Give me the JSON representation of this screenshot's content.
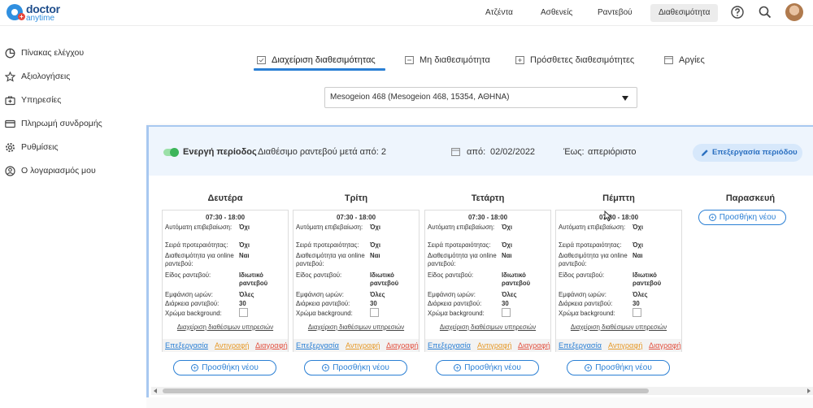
{
  "logo": {
    "line1": "doctor",
    "line2": "anytime"
  },
  "topnav": {
    "items": [
      {
        "label": "Ατζέντα"
      },
      {
        "label": "Ασθενείς"
      },
      {
        "label": "Ραντεβού"
      },
      {
        "label": "Διαθεσιμότητα",
        "active": true
      }
    ]
  },
  "sidebar": {
    "items": [
      {
        "label": "Πίνακας ελέγχου",
        "icon": "pie-chart-icon"
      },
      {
        "label": "Αξιολογήσεις",
        "icon": "star-icon"
      },
      {
        "label": "Υπηρεσίες",
        "icon": "medical-kit-icon"
      },
      {
        "label": "Πληρωμή συνδρομής",
        "icon": "credit-card-icon"
      },
      {
        "label": "Ρυθμίσεις",
        "icon": "gear-icon"
      },
      {
        "label": "Ο λογαριασμός μου",
        "icon": "user-circle-icon"
      }
    ]
  },
  "tabs": [
    {
      "label": "Διαχείριση διαθεσιμότητας",
      "active": true
    },
    {
      "label": "Μη διαθεσιμότητα"
    },
    {
      "label": "Πρόσθετες διαθεσιμότητες"
    },
    {
      "label": "Αργίες"
    }
  ],
  "location_select": {
    "value": "Mesogeion 468 (Mesogeion 468, 15354, ΑΘΗΝΑ)"
  },
  "period": {
    "status_label": "Ενεργή περίοδος",
    "booking_after": "Διαθέσιμο ραντεβού μετά από: 2",
    "from_label": "από:",
    "from_date": "02/02/2022",
    "to_label": "Έως:",
    "to_value": "απεριόριστο",
    "edit_label": "Επεξεργασία περιόδου"
  },
  "labels": {
    "auto_confirm": "Αυτόματη επιβεβαίωση:",
    "priority": "Σειρά προτεραιότητας:",
    "online": "Διαθεσιμότητα για online ραντεβού:",
    "type": "Είδος ραντεβού:",
    "show_hours": "Εμφάνιση ωρών:",
    "duration": "Διάρκεια ραντεβού:",
    "bg_color": "Χρώμα background:",
    "manage_services": "Διαχείριση διαθέσιμων υπηρεσιών",
    "edit": "Επεξεργασία",
    "copy": "Αντιγραφή",
    "delete": "Διαγραφή",
    "add_new": "Προσθήκη νέου"
  },
  "days": [
    {
      "name": "Δευτέρα",
      "time": "07:30 - 18:00",
      "auto_confirm": "Όχι",
      "priority": "Όχι",
      "online": "Ναι",
      "type": "Ιδιωτικό ραντεβού",
      "show_hours": "Όλες",
      "duration": "30"
    },
    {
      "name": "Τρίτη",
      "time": "07:30 - 18:00",
      "auto_confirm": "Όχι",
      "priority": "Όχι",
      "online": "Ναι",
      "type": "Ιδιωτικό ραντεβού",
      "show_hours": "Όλες",
      "duration": "30"
    },
    {
      "name": "Τετάρτη",
      "time": "07:30 - 18:00",
      "auto_confirm": "Όχι",
      "priority": "Όχι",
      "online": "Ναι",
      "type": "Ιδιωτικό ραντεβού",
      "show_hours": "Όλες",
      "duration": "30"
    },
    {
      "name": "Πέμπτη",
      "time": "07:30 - 18:00",
      "auto_confirm": "Όχι",
      "priority": "Όχι",
      "online": "Ναι",
      "type": "Ιδιωτικό ραντεβού",
      "show_hours": "Όλες",
      "duration": "30"
    },
    {
      "name": "Παρασκευή"
    }
  ],
  "colors": {
    "accent": "#2a7fd4",
    "copy": "#e69a2a",
    "delete": "#e25140",
    "active_toggle": "#3cb55a"
  }
}
